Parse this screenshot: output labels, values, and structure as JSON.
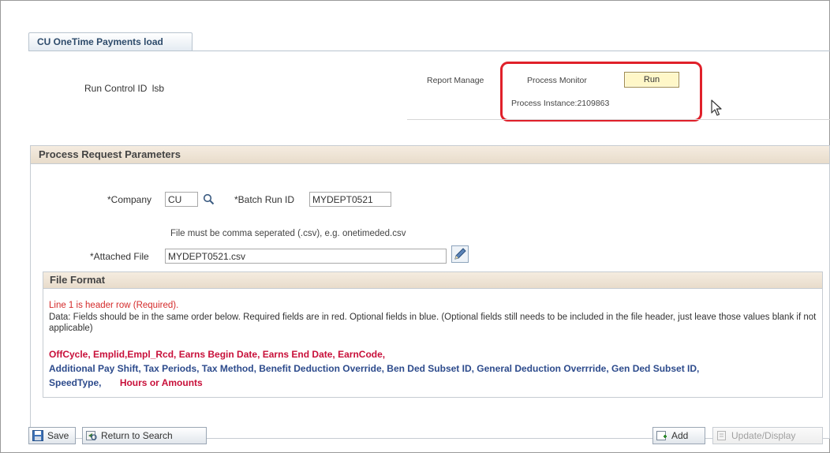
{
  "tab": {
    "label": "CU OneTime Payments load"
  },
  "run_control": {
    "label": "Run Control ID",
    "value": "lsb",
    "report_manager": "Report Manage",
    "process_monitor": "Process Monitor",
    "run_label": "Run",
    "process_instance": "Process Instance:2109863"
  },
  "params": {
    "header": "Process Request Parameters",
    "company_label": "*Company",
    "company_value": "CU",
    "batch_label": "*Batch Run ID",
    "batch_value": "MYDEPT0521",
    "file_hint": "File must be comma seperated (.csv), e.g. onetimeded.csv",
    "attached_label": "*Attached File",
    "attached_value": "MYDEPT0521.csv"
  },
  "file_format": {
    "header": "File Format",
    "line1": "Line 1 is header row (Required).",
    "data_desc": "Data: Fields should be in the same order below. Required fields are in red. Optional fields in blue. (Optional fields still needs to be included in the file header, just leave those values blank if not applicable)",
    "required_fields_1": "OffCycle, Emplid,Empl_Rcd, Earns Begin Date, Earns End Date, EarnCode,",
    "optional_fields_1": "Additional Pay Shift, Tax Periods, Tax Method, Benefit Deduction Override, Ben Ded Subset ID, General Deduction Overrride, Gen Ded Subset ID,",
    "optional_fields_2": "SpeedType,",
    "required_fields_2": "Hours or Amounts"
  },
  "toolbar": {
    "save": "Save",
    "return_to_search": "Return to Search",
    "add": "Add",
    "update_display": "Update/Display"
  },
  "colors": {
    "highlight": "#e0202a",
    "required": "#c8103a",
    "optional": "#2d4b8c",
    "header_bg": "#e8dccb"
  }
}
